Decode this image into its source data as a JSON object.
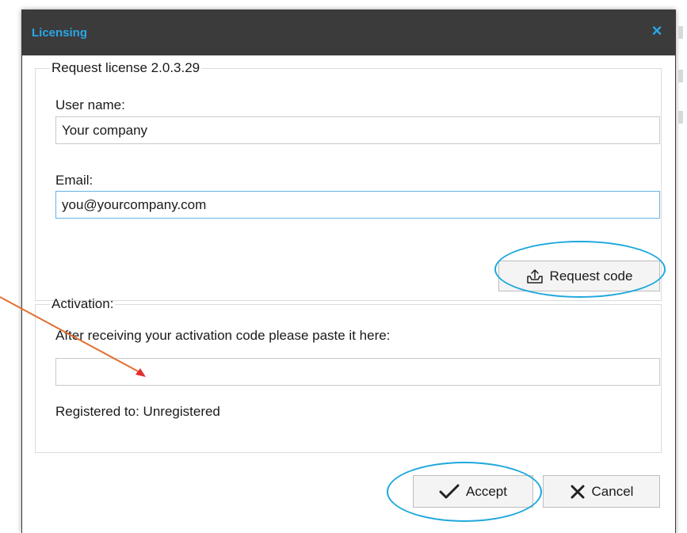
{
  "window": {
    "title": "Licensing",
    "close_glyph": "×"
  },
  "request": {
    "legend": "Request license 2.0.3.29",
    "username_label": "User name:",
    "username_value": "Your company",
    "email_label": "Email:",
    "email_value": "you@yourcompany.com",
    "request_button_label": "Request code",
    "request_button_icon": "upload-tray-icon"
  },
  "activation": {
    "legend": "Activation:",
    "instructions": "After receiving your activation code please paste it here:",
    "code_value": "",
    "registered_text": "Registered to: Unregistered"
  },
  "footer": {
    "accept_label": "Accept",
    "accept_icon": "checkmark-icon",
    "cancel_label": "Cancel",
    "cancel_icon": "x-mark-icon"
  },
  "colors": {
    "titlebar": "#3b3b3b",
    "title_text": "#29a6e6",
    "annotation_ellipse": "#1fa8dc",
    "annotation_arrow": "#e07030"
  }
}
